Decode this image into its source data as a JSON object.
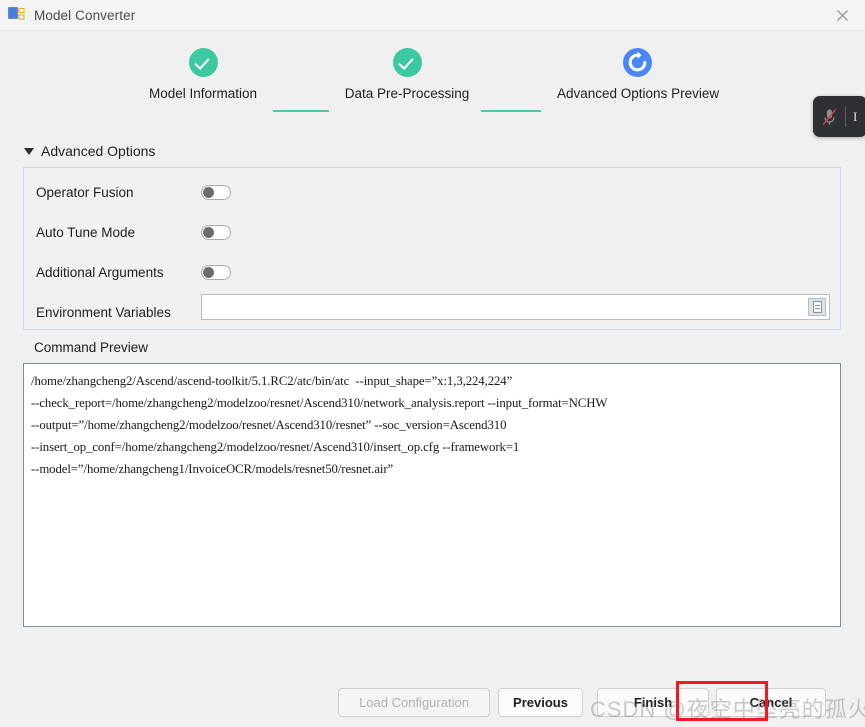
{
  "window": {
    "title": "Model Converter",
    "app_icon": "model-converter-icon",
    "close_label": "✕"
  },
  "stepper": {
    "steps": [
      {
        "label": "Model Information",
        "state": "done",
        "icon": "check-icon"
      },
      {
        "label": "Data Pre-Processing",
        "state": "done",
        "icon": "check-icon"
      },
      {
        "label": "Advanced Options  Preview",
        "state": "active",
        "icon": "loading-spinner-icon"
      }
    ]
  },
  "float_toolbar": {
    "mic_icon": "microphone-muted-icon",
    "extra_label": "I"
  },
  "advanced_options": {
    "header": "Advanced Options",
    "collapse_icon": "triangle-down-icon",
    "rows": [
      {
        "label": "Operator Fusion",
        "toggle": "off"
      },
      {
        "label": "Auto Tune Mode",
        "toggle": "off"
      },
      {
        "label": "Additional Arguments",
        "toggle": "off"
      }
    ],
    "env": {
      "label": "Environment Variables",
      "value": "",
      "placeholder": "",
      "browse_icon": "document-list-icon"
    }
  },
  "command_preview": {
    "label": "Command Preview",
    "lines": [
      "/home/zhangcheng2/Ascend/ascend-toolkit/5.1.RC2/atc/bin/atc  --input_shape=”x:1,3,224,224”",
      "--check_report=/home/zhangcheng2/modelzoo/resnet/Ascend310/network_analysis.report --input_format=NCHW",
      "--output=”/home/zhangcheng2/modelzoo/resnet/Ascend310/resnet” --soc_version=Ascend310",
      "--insert_op_conf=/home/zhangcheng2/modelzoo/resnet/Ascend310/insert_op.cfg --framework=1",
      "--model=”/home/zhangcheng1/InvoiceOCR/models/resnet50/resnet.air”"
    ]
  },
  "buttons": {
    "load_configuration": "Load Configuration",
    "previous": "Previous",
    "finish": "Finish",
    "cancel": "Cancel"
  },
  "annotation": {
    "highlight_color": "#f5181d",
    "target": "finish"
  },
  "watermark": {
    "text": "CSDN @夜空中坠亮的孤火星"
  }
}
